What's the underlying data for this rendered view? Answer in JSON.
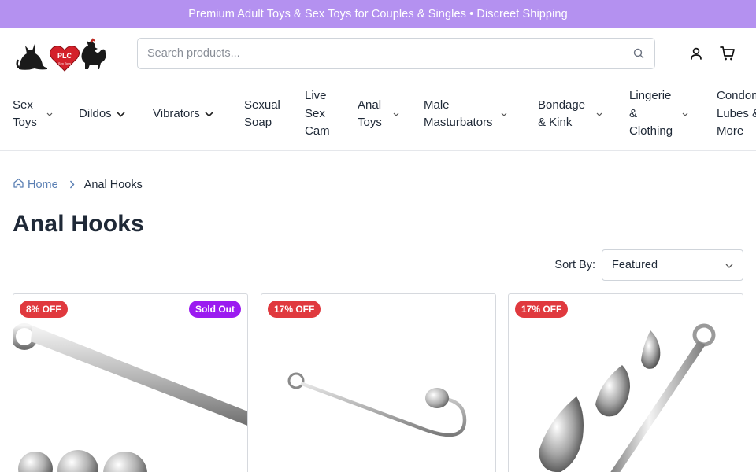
{
  "announcement": "Premium Adult Toys & Sex Toys for Couples & Singles • Discreet Shipping",
  "logo": {
    "text": "PLC",
    "subtext": "Sex Toys"
  },
  "search": {
    "placeholder": "Search products..."
  },
  "header_icons": [
    "account-icon",
    "cart-icon"
  ],
  "nav": {
    "items": [
      {
        "label": "Sex\nToys",
        "dropdown": true
      },
      {
        "label": "Dildos",
        "dropdown": true
      },
      {
        "label": "Vibrators",
        "dropdown": true
      },
      {
        "label": "Sexual\nSoap",
        "dropdown": false
      },
      {
        "label": "Live\nSex\nCam",
        "dropdown": false
      },
      {
        "label": "Anal\nToys",
        "dropdown": true
      },
      {
        "label": "Male\nMasturbators",
        "dropdown": true
      },
      {
        "label": "Bondage\n& Kink",
        "dropdown": true
      },
      {
        "label": "Lingerie\n&\nClothing",
        "dropdown": true
      },
      {
        "label": "Condom\nLubes &\nMore",
        "dropdown": false
      }
    ]
  },
  "breadcrumb": {
    "home": "Home",
    "current": "Anal Hooks"
  },
  "page_title": "Anal Hooks",
  "sort": {
    "label": "Sort By:",
    "selected": "Featured"
  },
  "products": [
    {
      "discount": "8% OFF",
      "status": "Sold Out"
    },
    {
      "discount": "17% OFF",
      "status": ""
    },
    {
      "discount": "17% OFF",
      "status": ""
    }
  ],
  "colors": {
    "announcement_bg": "#b491f0",
    "discount_badge": "#e0393e",
    "sold_out_badge": "#9b1bf0",
    "link": "#5a7fb3",
    "text": "#1f2937"
  }
}
